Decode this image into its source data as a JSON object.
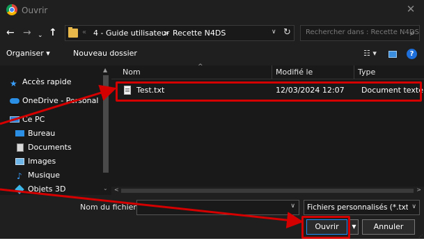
{
  "window": {
    "title": "Ouvrir",
    "close_glyph": "✕",
    "icon": "chrome-icon"
  },
  "address": {
    "overflow": "«",
    "crumbs": [
      "4 - Guide utilisateur",
      "Recette N4DS"
    ],
    "separator": ">",
    "dropdown_glyph": "∨",
    "refresh_glyph": "↻"
  },
  "nav_buttons": {
    "back": "←",
    "forward": "→",
    "recent": "⌄",
    "up": "↑"
  },
  "search": {
    "placeholder": "Rechercher dans : Recette N4DS",
    "icon": "🔍"
  },
  "toolbar": {
    "organize": "Organiser ▾",
    "new_folder": "Nouveau dossier",
    "view": "☷ ▾",
    "help": "?"
  },
  "sidebar": {
    "items": [
      {
        "label": "Accès rapide",
        "icon": "star-icon"
      },
      {
        "label": "OneDrive - Personal",
        "icon": "cloud-icon"
      },
      {
        "label": "Ce PC",
        "icon": "pc-icon"
      },
      {
        "label": "Bureau",
        "icon": "desktop-icon"
      },
      {
        "label": "Documents",
        "icon": "documents-icon"
      },
      {
        "label": "Images",
        "icon": "images-icon"
      },
      {
        "label": "Musique",
        "icon": "music-icon"
      },
      {
        "label": "Objets 3D",
        "icon": "cube-icon"
      }
    ]
  },
  "file_list": {
    "columns": {
      "name": "Nom",
      "modified": "Modifié le",
      "type": "Type"
    },
    "rows": [
      {
        "name": "Test.txt",
        "modified": "12/03/2024 12:07",
        "type": "Document texte"
      }
    ]
  },
  "bottom": {
    "filename_label": "Nom du fichier :",
    "filename_value": "",
    "filetype": "Fichiers personnalisés (*.txt;*.ds",
    "open": "Ouvrir",
    "cancel": "Annuler"
  },
  "colors": {
    "background": "#1f1f1f",
    "pane": "#191919",
    "highlight": "#d40000",
    "folder": "#e8b84a",
    "accent": "#1e90ff"
  }
}
